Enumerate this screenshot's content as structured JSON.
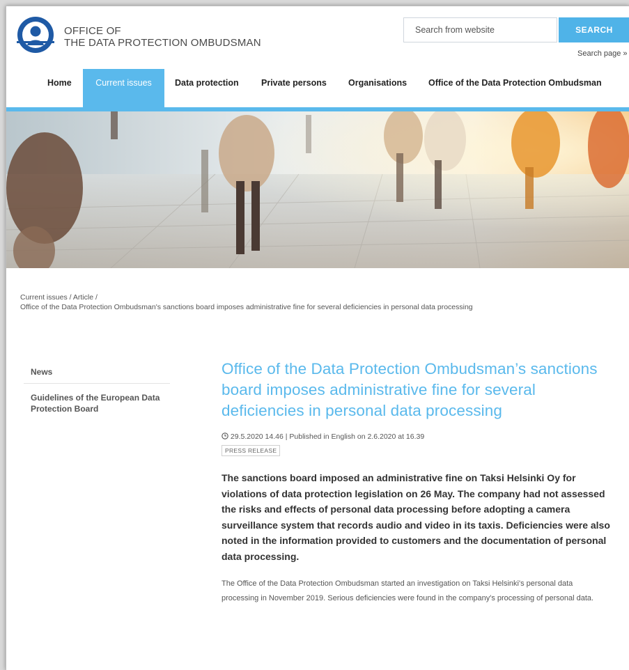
{
  "header": {
    "logo_line1": "OFFICE OF",
    "logo_line2": "THE DATA PROTECTION OMBUDSMAN",
    "search_placeholder": "Search from website",
    "search_button": "SEARCH",
    "search_page_link": "Search page »"
  },
  "nav": {
    "items": [
      {
        "label": "Home"
      },
      {
        "label": "Current issues"
      },
      {
        "label": "Data protection"
      },
      {
        "label": "Private persons"
      },
      {
        "label": "Organisations"
      },
      {
        "label": "Office of the Data Protection Ombudsman"
      }
    ],
    "active_index": 1
  },
  "breadcrumb": {
    "current_issues": "Current issues",
    "sep": " / ",
    "article": "Article",
    "page": "Office of the Data Protection Ombudsman's sanctions board imposes administrative fine for several deficiencies in personal data processing"
  },
  "sidebar": {
    "items": [
      {
        "label": "News"
      },
      {
        "label": "Guidelines of the European Data Protection Board"
      }
    ]
  },
  "article": {
    "title": "Office of the Data Protection Ombudsman’s sanctions board imposes administrative fine for several deficiencies in personal data processing",
    "meta": "29.5.2020 14.46 | Published in English on 2.6.2020 at 16.39",
    "badge": "PRESS RELEASE",
    "lead": "The sanctions board imposed an administrative fine on Taksi Helsinki Oy for violations of data protection legislation on 26 May. The company had not assessed the risks and effects of personal data processing before adopting a camera surveillance system that records audio and video in its taxis. Deficiencies were also noted in the information provided to customers and the documentation of personal data processing.",
    "body": "The Office of the Data Protection Ombudsman started an investigation on Taksi Helsinki's personal data processing in November 2019. Serious deficiencies were found in the company's processing of personal data."
  },
  "colors": {
    "accent": "#5ab9ec",
    "logo_blue": "#1f5aa5",
    "text": "#333333"
  }
}
